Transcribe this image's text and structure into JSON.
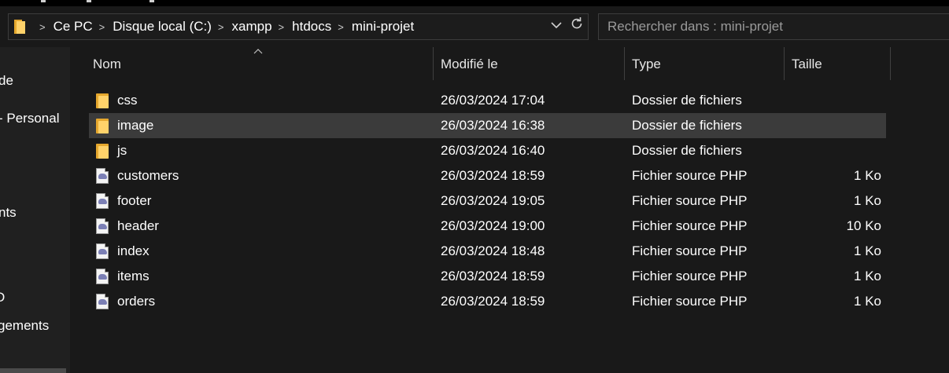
{
  "addressbar": {
    "breadcrumbs": [
      "Ce PC",
      "Disque local (C:)",
      "xampp",
      "htdocs",
      "mini-projet"
    ],
    "icons": [
      "folder-icon",
      "chevron-right-icon",
      "chevron-down-icon",
      "refresh-icon"
    ]
  },
  "search": {
    "placeholder": "Rechercher dans : mini-projet"
  },
  "navpane": {
    "items": [
      "de",
      "- Personal",
      "nts",
      "D",
      "gements"
    ]
  },
  "columns": {
    "name": "Nom",
    "modified": "Modifié le",
    "type": "Type",
    "size": "Taille"
  },
  "files": [
    {
      "name": "css",
      "modified": "26/03/2024 17:04",
      "type": "Dossier de fichiers",
      "size": "",
      "icon": "folder-icon"
    },
    {
      "name": "image",
      "modified": "26/03/2024 16:38",
      "type": "Dossier de fichiers",
      "size": "",
      "icon": "folder-icon",
      "selected": true
    },
    {
      "name": "js",
      "modified": "26/03/2024 16:40",
      "type": "Dossier de fichiers",
      "size": "",
      "icon": "folder-icon"
    },
    {
      "name": "customers",
      "modified": "26/03/2024 18:59",
      "type": "Fichier source PHP",
      "size": "1 Ko",
      "icon": "php-file-icon"
    },
    {
      "name": "footer",
      "modified": "26/03/2024 19:05",
      "type": "Fichier source PHP",
      "size": "1 Ko",
      "icon": "php-file-icon"
    },
    {
      "name": "header",
      "modified": "26/03/2024 19:00",
      "type": "Fichier source PHP",
      "size": "10 Ko",
      "icon": "php-file-icon"
    },
    {
      "name": "index",
      "modified": "26/03/2024 18:48",
      "type": "Fichier source PHP",
      "size": "1 Ko",
      "icon": "php-file-icon"
    },
    {
      "name": "items",
      "modified": "26/03/2024 18:59",
      "type": "Fichier source PHP",
      "size": "1 Ko",
      "icon": "php-file-icon"
    },
    {
      "name": "orders",
      "modified": "26/03/2024 18:59",
      "type": "Fichier source PHP",
      "size": "1 Ko",
      "icon": "php-file-icon"
    }
  ],
  "colors": {
    "background": "#191919",
    "nav_background": "#202020",
    "selected_row": "#3b3b3b",
    "folder": "#ffd26a"
  }
}
